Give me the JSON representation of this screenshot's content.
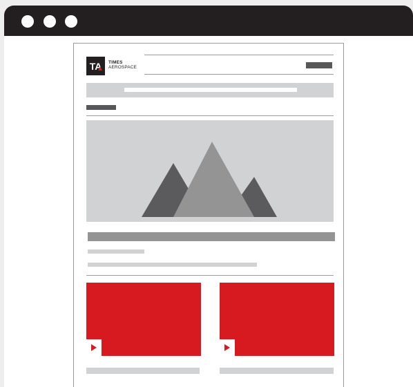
{
  "logo": {
    "mark": "TA",
    "line1": "TIMES",
    "line2": "AEROSPACE"
  },
  "colors": {
    "frame": "#231f20",
    "accent_red": "#d71920",
    "placeholder_light": "#d1d2d3",
    "placeholder_mid": "#949495",
    "placeholder_dark": "#58585a"
  },
  "icons": [
    "image-placeholder-icon",
    "play-icon"
  ]
}
